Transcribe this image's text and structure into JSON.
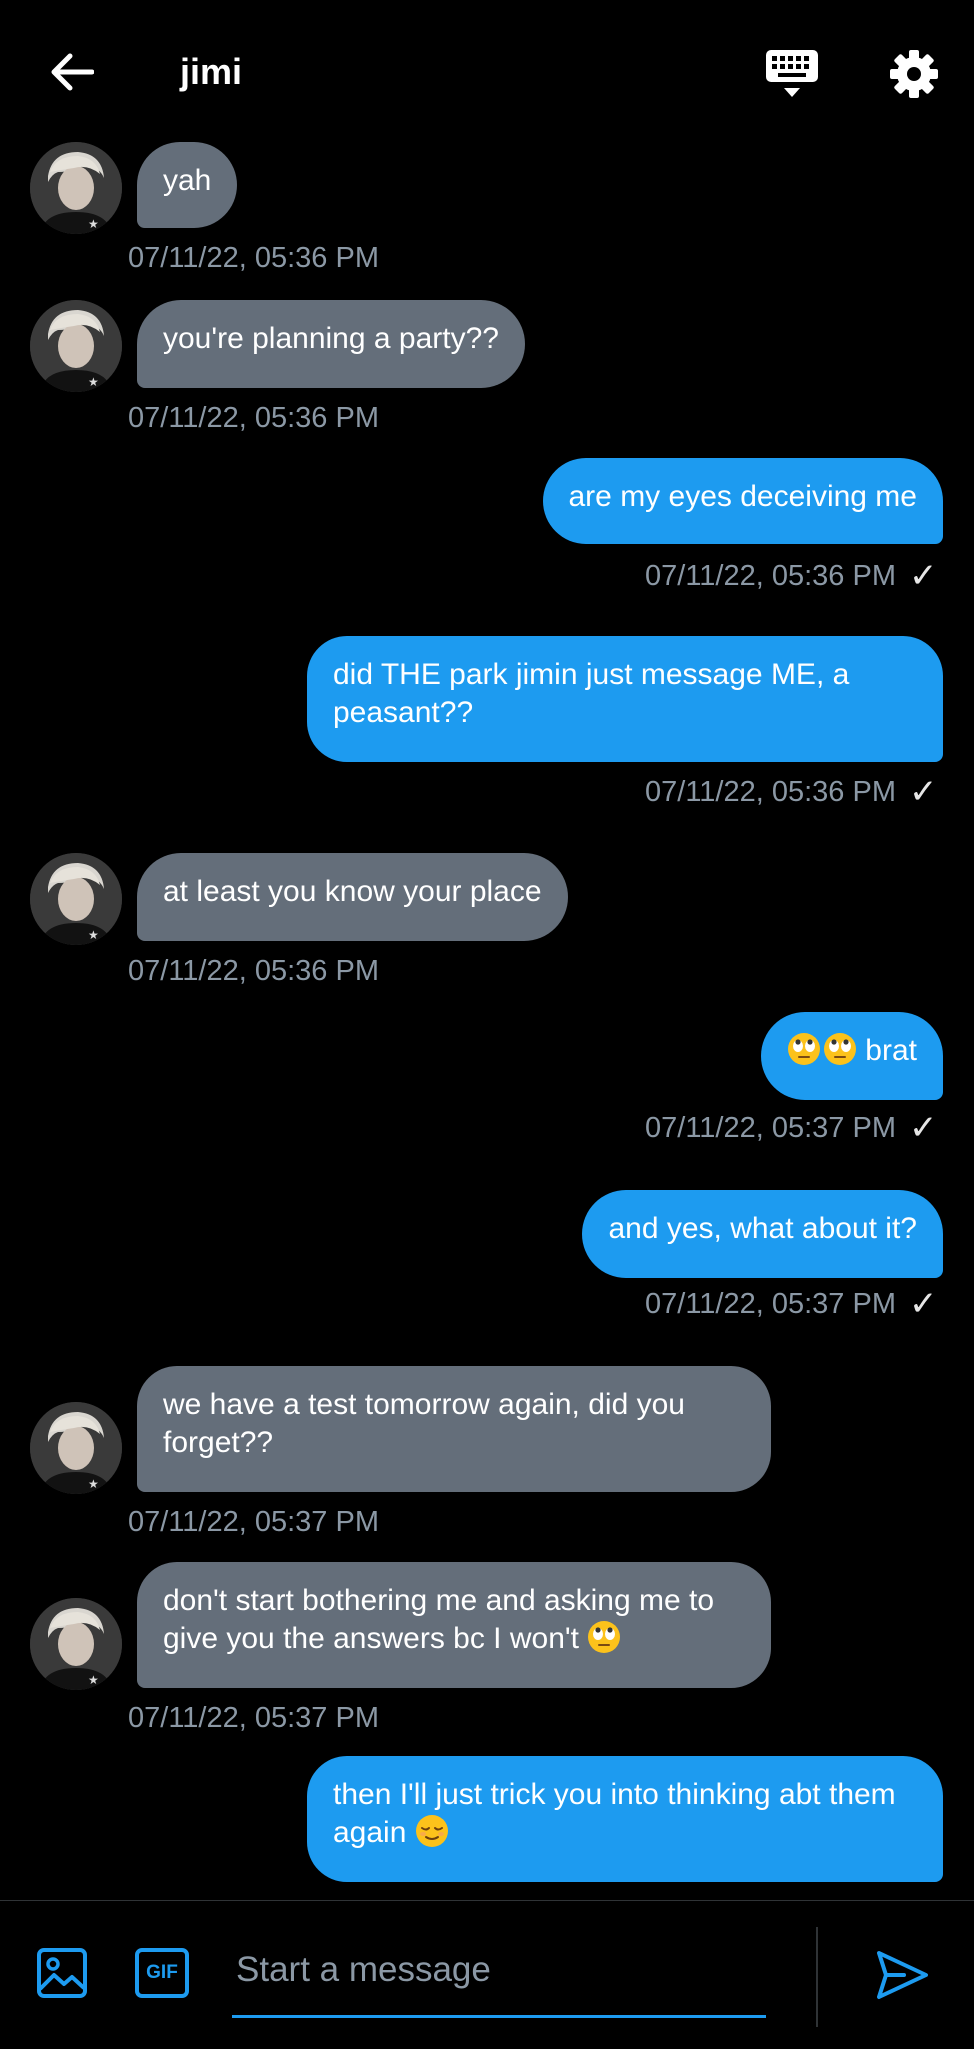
{
  "header": {
    "title": "jimi",
    "back_icon": "arrow-left-icon",
    "keyboard_icon": "keyboard-icon",
    "settings_icon": "gear-icon"
  },
  "messages": [
    {
      "side": "in",
      "text": "yah",
      "time": "07/11/22, 05:36 PM"
    },
    {
      "side": "in",
      "text": "you're planning a party??",
      "time": "07/11/22, 05:36 PM"
    },
    {
      "side": "out",
      "text": "are my eyes deceiving me",
      "time": "07/11/22, 05:36 PM"
    },
    {
      "side": "out",
      "text": "did THE park jimin just message ME, a peasant??",
      "time": "07/11/22, 05:36 PM"
    },
    {
      "side": "in",
      "text": "at least you know your place",
      "time": "07/11/22, 05:36 PM"
    },
    {
      "side": "out",
      "text": "brat",
      "emoji_before": "eye-roll-emoji x2",
      "time": "07/11/22, 05:37 PM"
    },
    {
      "side": "out",
      "text": "and yes, what about it?",
      "time": "07/11/22, 05:37 PM"
    },
    {
      "side": "in",
      "text": "we have a test tomorrow again, did you forget??",
      "time": "07/11/22, 05:37 PM"
    },
    {
      "side": "in",
      "text": "don't start bothering me and asking me to give you the answers bc I won't",
      "emoji_after": "eye-roll-emoji",
      "time": "07/11/22, 05:37 PM"
    },
    {
      "side": "out",
      "text": "then I'll just trick you into thinking abt them again",
      "emoji_after": "relieved-emoji"
    }
  ],
  "read_check": "✓",
  "composer": {
    "placeholder": "Start a message",
    "media_icon": "image-icon",
    "gif_label": "GIF",
    "send_icon": "send-icon"
  },
  "colors": {
    "background": "#000000",
    "incoming_bubble": "#646e7a",
    "outgoing_bubble": "#1d9bf0",
    "timestamp": "#8b98a5",
    "accent": "#1d9bf0"
  }
}
